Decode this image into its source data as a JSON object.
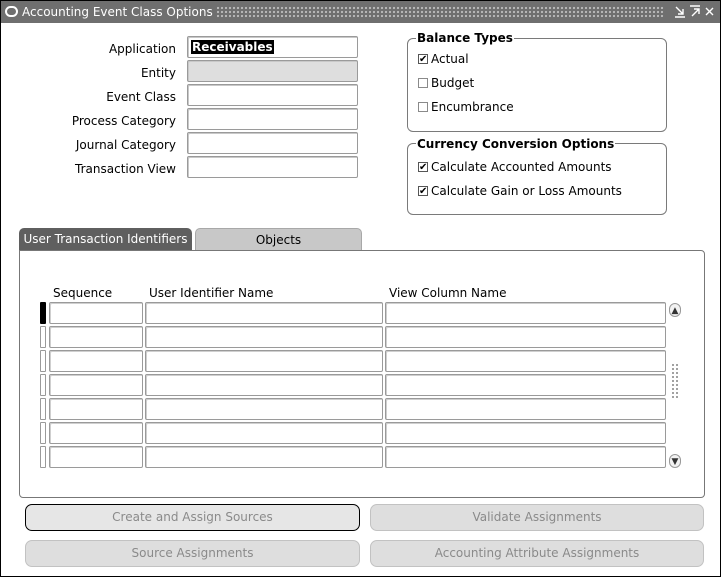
{
  "window": {
    "title": "Accounting Event Class Options"
  },
  "form": {
    "application_label": "Application",
    "application_value": "Receivables",
    "entity_label": "Entity",
    "event_class_label": "Event Class",
    "process_category_label": "Process Category",
    "journal_category_label": "Journal Category",
    "transaction_view_label": "Transaction View"
  },
  "balance_types": {
    "title": "Balance Types",
    "items": [
      {
        "label": "Actual",
        "checked": true
      },
      {
        "label": "Budget",
        "checked": false
      },
      {
        "label": "Encumbrance",
        "checked": false
      }
    ]
  },
  "currency_options": {
    "title": "Currency Conversion Options",
    "items": [
      {
        "label": "Calculate Accounted Amounts",
        "checked": true
      },
      {
        "label": "Calculate Gain or Loss Amounts",
        "checked": true
      }
    ]
  },
  "tabs": [
    {
      "label": "User Transaction Identifiers",
      "active": true
    },
    {
      "label": "Objects",
      "active": false
    }
  ],
  "grid": {
    "headers": [
      "Sequence",
      "User Identifier Name",
      "View Column Name"
    ],
    "row_count": 7
  },
  "buttons": {
    "create_assign": "Create and Assign Sources",
    "validate": "Validate Assignments",
    "source_assignments": "Source Assignments",
    "accounting_attribute": "Accounting Attribute Assignments"
  },
  "icons": {
    "minimize": "minimize-icon",
    "maximize": "maximize-icon",
    "scroll_up": "scroll-up-icon",
    "scroll_down": "scroll-down-icon"
  }
}
